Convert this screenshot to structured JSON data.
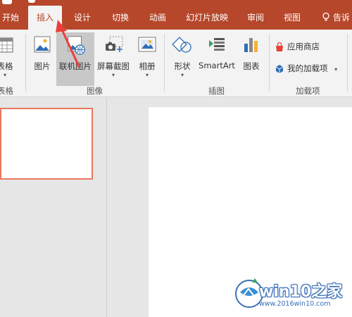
{
  "tabs": [
    {
      "label": "开始"
    },
    {
      "label": "插入",
      "active": true
    },
    {
      "label": "设计"
    },
    {
      "label": "切换"
    },
    {
      "label": "动画"
    },
    {
      "label": "幻灯片放映"
    },
    {
      "label": "审阅"
    },
    {
      "label": "视图"
    }
  ],
  "tell_me": "告诉",
  "ribbon": {
    "table_group": {
      "button_label": "表格",
      "group_label": "表格"
    },
    "images_group": {
      "buttons": [
        "图片",
        "联机图片",
        "屏幕截图",
        "相册"
      ],
      "group_label": "图像"
    },
    "illustrations_group": {
      "buttons": [
        "形状",
        "SmartArt",
        "图表"
      ],
      "group_label": "插图"
    },
    "addins_group": {
      "store_label": "应用商店",
      "my_addins_label": "我的加载项",
      "group_label": "加载项"
    }
  },
  "watermark": {
    "brand": "win10之家",
    "url": "www.2016win10.com"
  },
  "colors": {
    "accent": "#b7472a",
    "selection": "#e8785e",
    "annotation_arrow": "#e8403a"
  }
}
